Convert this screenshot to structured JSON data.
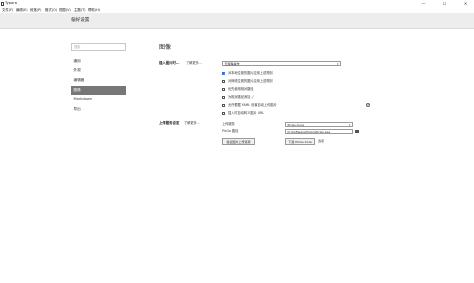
{
  "window": {
    "title": "Typora",
    "minimize": "—",
    "maximize": "☐",
    "close": "✕"
  },
  "menu": [
    "文件(F)",
    "编辑(E)",
    "段落(P)",
    "格式(O)",
    "视图(V)",
    "主题(T)",
    "帮助(H)"
  ],
  "header": {
    "title": "偏好设置"
  },
  "sidebar": {
    "search_placeholder": "搜索",
    "items": [
      {
        "label": "通用"
      },
      {
        "label": "外观"
      },
      {
        "label": "编辑器"
      },
      {
        "label": "图像",
        "active": true
      },
      {
        "label": "Markdown"
      },
      {
        "label": "导出"
      }
    ]
  },
  "image": {
    "title": "图像",
    "insert": {
      "label": "插入图片时…",
      "sublabel": "了解更多…",
      "action_value": "无特殊操作",
      "options": [
        {
          "label": "对本地位置的图片应用上述规则",
          "checked": true
        },
        {
          "label": "对网络位置的图片应用上述规则",
          "checked": false
        },
        {
          "label": "优先使用相对路径",
          "checked": false
        },
        {
          "label": "为相对路径添加 ./",
          "checked": false
        },
        {
          "label": "允许根据 YAML 设置自动上传图片",
          "checked": false
        },
        {
          "label": "插入时自动转义图片 URL",
          "checked": false
        }
      ],
      "help_icon": "?"
    },
    "upload": {
      "label": "上传服务设定",
      "sublabel": "了解更多…",
      "service_label": "上传服务",
      "service_value": "PicGo-Core",
      "path_label": "PicGo 路径",
      "path_value": "D:\\Software\\PicGo\\PicGo.exe",
      "verify_button": "验证图片上传选项",
      "download_button": "下载 PicGo-Core",
      "open_link": "选项"
    }
  }
}
